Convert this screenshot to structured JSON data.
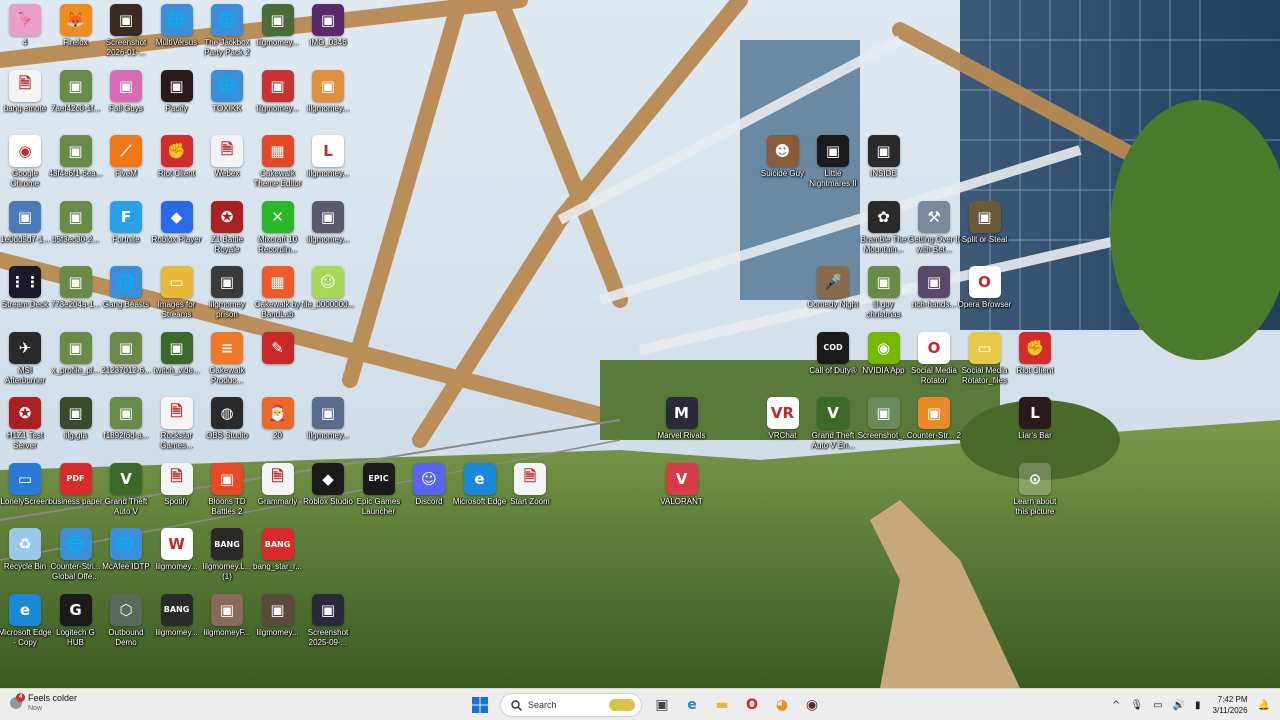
{
  "desktop": {
    "icons": [
      {
        "label": "4",
        "col": 0,
        "row": 0,
        "color": "#e8a0c8",
        "glyph": "🦩"
      },
      {
        "label": "Firefox",
        "col": 1,
        "row": 0,
        "color": "#f28b1f",
        "glyph": "🦊"
      },
      {
        "label": "Screenshot 2026-01-...",
        "col": 2,
        "row": 0,
        "color": "#3a2a22",
        "glyph": "▣"
      },
      {
        "label": "MultiVersus",
        "col": 3,
        "row": 0,
        "color": "#3b8fd8",
        "glyph": "🌐"
      },
      {
        "label": "The Jackbox Party Pack 2",
        "col": 4,
        "row": 0,
        "color": "#3b8fd8",
        "glyph": "🌐"
      },
      {
        "label": "lilgmomey...",
        "col": 5,
        "row": 0,
        "color": "#4a6b3a",
        "glyph": "▣"
      },
      {
        "label": "IMG_0346",
        "col": 6,
        "row": 0,
        "color": "#5a2a6a",
        "glyph": "▣"
      },
      {
        "label": "bang emote",
        "col": 0,
        "row": 1,
        "color": "#f4f4f4",
        "glyph": "🗎"
      },
      {
        "label": "7aef42c0-1f...",
        "col": 1,
        "row": 1,
        "color": "#6a8a4a",
        "glyph": "▣"
      },
      {
        "label": "Fall Guys",
        "col": 2,
        "row": 1,
        "color": "#d96ab4",
        "glyph": "▣"
      },
      {
        "label": "Pacify",
        "col": 3,
        "row": 1,
        "color": "#2a1a1a",
        "glyph": "▣"
      },
      {
        "label": "TOXIKK",
        "col": 4,
        "row": 1,
        "color": "#3b8fd8",
        "glyph": "🌐"
      },
      {
        "label": "lilgmomey...",
        "col": 5,
        "row": 1,
        "color": "#c83232",
        "glyph": "▣"
      },
      {
        "label": "lilgmomey...",
        "col": 6,
        "row": 1,
        "color": "#e09040",
        "glyph": "▣"
      },
      {
        "label": "Google Chrome",
        "col": 0,
        "row": 2,
        "color": "#ffffff",
        "glyph": "◉"
      },
      {
        "label": "43f4e6f1-6ea...",
        "col": 1,
        "row": 2,
        "color": "#6a8a4a",
        "glyph": "▣"
      },
      {
        "label": "FiveM",
        "col": 2,
        "row": 2,
        "color": "#f07818",
        "glyph": "⟋"
      },
      {
        "label": "Riot Client",
        "col": 3,
        "row": 2,
        "color": "#d32c2c",
        "glyph": "✊"
      },
      {
        "label": "Webex",
        "col": 4,
        "row": 2,
        "color": "#f4f4f4",
        "glyph": "🗎"
      },
      {
        "label": "Cakewalk Theme Editor",
        "col": 5,
        "row": 2,
        "color": "#e04828",
        "glyph": "▦"
      },
      {
        "label": "lilgmomey...",
        "col": 6,
        "row": 2,
        "color": "#ffffff",
        "glyph": "L"
      },
      {
        "label": "1e0dd5d7-1...",
        "col": 0,
        "row": 3,
        "color": "#4a7ab8",
        "glyph": "▣"
      },
      {
        "label": "b5f3ec30-2...",
        "col": 1,
        "row": 3,
        "color": "#6a8a4a",
        "glyph": "▣"
      },
      {
        "label": "Fortnite",
        "col": 2,
        "row": 3,
        "color": "#2aa0e8",
        "glyph": "F"
      },
      {
        "label": "Roblox Player",
        "col": 3,
        "row": 3,
        "color": "#2a6ae8",
        "glyph": "◆"
      },
      {
        "label": "Z1 Battle Royale",
        "col": 4,
        "row": 3,
        "color": "#a82020",
        "glyph": "✪"
      },
      {
        "label": "Mixcraft 10 Recordin...",
        "col": 5,
        "row": 3,
        "color": "#28b828",
        "glyph": "✕"
      },
      {
        "label": "lilgmomey...",
        "col": 6,
        "row": 3,
        "color": "#5a5a6a",
        "glyph": "▣"
      },
      {
        "label": "Stream Deck",
        "col": 0,
        "row": 4,
        "color": "#1a1a2a",
        "glyph": "⋮⋮"
      },
      {
        "label": "773e204a-1...",
        "col": 1,
        "row": 4,
        "color": "#6a8a4a",
        "glyph": "▣"
      },
      {
        "label": "Gang Beasts",
        "col": 2,
        "row": 4,
        "color": "#3b8fd8",
        "glyph": "🌐"
      },
      {
        "label": "Images for Streams",
        "col": 3,
        "row": 4,
        "color": "#e8b838",
        "glyph": "▭"
      },
      {
        "label": "lilgmomey prison",
        "col": 4,
        "row": 4,
        "color": "#3a3a3a",
        "glyph": "▣"
      },
      {
        "label": "Cakewalk by BandLab",
        "col": 5,
        "row": 4,
        "color": "#f05a28",
        "glyph": "▦"
      },
      {
        "label": "file_0000000...",
        "col": 6,
        "row": 4,
        "color": "#a8d858",
        "glyph": "☺"
      },
      {
        "label": "MSI Afterburner",
        "col": 0,
        "row": 5,
        "color": "#2a2a2a",
        "glyph": "✈"
      },
      {
        "label": "x_profile_pl...",
        "col": 1,
        "row": 5,
        "color": "#6a8a4a",
        "glyph": "▣"
      },
      {
        "label": "21237012-6...",
        "col": 2,
        "row": 5,
        "color": "#6a8a4a",
        "glyph": "▣"
      },
      {
        "label": "twitch_vide...",
        "col": 3,
        "row": 5,
        "color": "#3a6a2a",
        "glyph": "▣"
      },
      {
        "label": "Cakewalk Produc...",
        "col": 4,
        "row": 5,
        "color": "#f07828",
        "glyph": "≡"
      },
      {
        "label": "",
        "col": 5,
        "row": 5,
        "color": "#c82828",
        "glyph": "✎"
      },
      {
        "label": "H1Z1 Test Server",
        "col": 0,
        "row": 6,
        "color": "#a82020",
        "glyph": "✪"
      },
      {
        "label": "lilg.gta",
        "col": 1,
        "row": 6,
        "color": "#3a4a2a",
        "glyph": "▣"
      },
      {
        "label": "f1892f6d-a...",
        "col": 2,
        "row": 6,
        "color": "#6a8a4a",
        "glyph": "▣"
      },
      {
        "label": "Rockstar Games...",
        "col": 3,
        "row": 6,
        "color": "#f4f4f4",
        "glyph": "🗎"
      },
      {
        "label": "OBS Studio",
        "col": 4,
        "row": 6,
        "color": "#2a2a2a",
        "glyph": "◍"
      },
      {
        "label": "20",
        "col": 5,
        "row": 6,
        "color": "#e86828",
        "glyph": "🎅"
      },
      {
        "label": "lilgmomey...",
        "col": 6,
        "row": 6,
        "color": "#5a6a8a",
        "glyph": "▣"
      },
      {
        "label": "LonelyScreen",
        "col": 0,
        "row": 7,
        "color": "#2a78d8",
        "glyph": "▭"
      },
      {
        "label": "business paper",
        "col": 1,
        "row": 7,
        "color": "#d82a2a",
        "glyph": "PDF"
      },
      {
        "label": "Grand Theft Auto V",
        "col": 2,
        "row": 7,
        "color": "#3a6a2a",
        "glyph": "V"
      },
      {
        "label": "Spotify",
        "col": 3,
        "row": 7,
        "color": "#f4f4f4",
        "glyph": "🗎"
      },
      {
        "label": "Bloons TD Battles 2",
        "col": 4,
        "row": 7,
        "color": "#e84828",
        "glyph": "▣"
      },
      {
        "label": "Grammarly",
        "col": 5,
        "row": 7,
        "color": "#f4f4f4",
        "glyph": "🗎"
      },
      {
        "label": "Roblox Studio",
        "col": 6,
        "row": 7,
        "color": "#1a1a1a",
        "glyph": "◆"
      },
      {
        "label": "Epic Games Launcher",
        "col": 7,
        "row": 7,
        "color": "#1a1a1a",
        "glyph": "EPIC"
      },
      {
        "label": "Discord",
        "col": 8,
        "row": 7,
        "color": "#5865f2",
        "glyph": "☺"
      },
      {
        "label": "Microsoft Edge",
        "col": 9,
        "row": 7,
        "color": "#1a8ad8",
        "glyph": "e"
      },
      {
        "label": "Start Zoom",
        "col": 10,
        "row": 7,
        "color": "#f4f4f4",
        "glyph": "🗎"
      },
      {
        "label": "Recycle Bin",
        "col": 0,
        "row": 8,
        "color": "#9ac8e8",
        "glyph": "♻"
      },
      {
        "label": "Counter-Stri... Global Offe...",
        "col": 1,
        "row": 8,
        "color": "#3b8fd8",
        "glyph": "🌐"
      },
      {
        "label": "McAfee IDTP",
        "col": 2,
        "row": 8,
        "color": "#3b8fd8",
        "glyph": "🌐"
      },
      {
        "label": "lilgmomey...",
        "col": 3,
        "row": 8,
        "color": "#ffffff",
        "glyph": "W"
      },
      {
        "label": "lilgmomey.L... (1)",
        "col": 4,
        "row": 8,
        "color": "#2a2a2a",
        "glyph": "BANG"
      },
      {
        "label": "bang_star_r...",
        "col": 5,
        "row": 8,
        "color": "#d82a2a",
        "glyph": "BANG"
      },
      {
        "label": "Microsoft Edge - Copy",
        "col": 0,
        "row": 9,
        "color": "#1a8ad8",
        "glyph": "e"
      },
      {
        "label": "Logitech G HUB",
        "col": 1,
        "row": 9,
        "color": "#1a1a1a",
        "glyph": "G"
      },
      {
        "label": "Outbound Demo",
        "col": 2,
        "row": 9,
        "color": "#5a6a5a",
        "glyph": "⬡"
      },
      {
        "label": "lilgmomey...",
        "col": 3,
        "row": 9,
        "color": "#2a2a2a",
        "glyph": "BANG"
      },
      {
        "label": "lilgmomeyF...",
        "col": 4,
        "row": 9,
        "color": "#8a6a5a",
        "glyph": "▣"
      },
      {
        "label": "lilgmomey...",
        "col": 5,
        "row": 9,
        "color": "#5a4a3a",
        "glyph": "▣"
      },
      {
        "label": "Screenshot 2025-09-...",
        "col": 6,
        "row": 9,
        "color": "#2a2a3a",
        "glyph": "▣"
      },
      {
        "label": "Suicide Guy",
        "col": 15,
        "row": 2,
        "color": "#8a5a3a",
        "glyph": "☻"
      },
      {
        "label": "Little Nightmares II",
        "col": 16,
        "row": 2,
        "color": "#1a1a1a",
        "glyph": "▣"
      },
      {
        "label": "INSIDE",
        "col": 17,
        "row": 2,
        "color": "#2a2a2a",
        "glyph": "▣"
      },
      {
        "label": "Bramble The Mountain...",
        "col": 17,
        "row": 3,
        "color": "#2a2a2a",
        "glyph": "✿"
      },
      {
        "label": "Getting Over It with Bet...",
        "col": 18,
        "row": 3,
        "color": "#7a8a9a",
        "glyph": "⚒"
      },
      {
        "label": "Split or Steal",
        "col": 19,
        "row": 3,
        "color": "#6a5a3a",
        "glyph": "▣"
      },
      {
        "label": "Comedy Night",
        "col": 16,
        "row": 4,
        "color": "#8a6a4a",
        "glyph": "🎤"
      },
      {
        "label": "lil guy christmas",
        "col": 17,
        "row": 4,
        "color": "#6a8a4a",
        "glyph": "▣"
      },
      {
        "label": "rich-hands...",
        "col": 18,
        "row": 4,
        "color": "#5a4a6a",
        "glyph": "▣"
      },
      {
        "label": "Opera Browser",
        "col": 19,
        "row": 4,
        "color": "#ffffff",
        "glyph": "O"
      },
      {
        "label": "Call of Duty®",
        "col": 16,
        "row": 5,
        "color": "#1a1a1a",
        "glyph": "COD"
      },
      {
        "label": "NVIDIA App",
        "col": 17,
        "row": 5,
        "color": "#76b900",
        "glyph": "◉"
      },
      {
        "label": "Social Media Rotator",
        "col": 18,
        "row": 5,
        "color": "#ffffff",
        "glyph": "O"
      },
      {
        "label": "Social Media Rotator_files",
        "col": 19,
        "row": 5,
        "color": "#e8c848",
        "glyph": "▭"
      },
      {
        "label": "Riot Client",
        "col": 20,
        "row": 5,
        "color": "#d32c2c",
        "glyph": "✊"
      },
      {
        "label": "Marvel Rivals",
        "col": 13,
        "row": 6,
        "color": "#2a2a3a",
        "glyph": "M"
      },
      {
        "label": "VRChat",
        "col": 15,
        "row": 6,
        "color": "#ffffff",
        "glyph": "VR"
      },
      {
        "label": "Grand Theft Auto V En...",
        "col": 16,
        "row": 6,
        "color": "#3a6a2a",
        "glyph": "V"
      },
      {
        "label": "Screenshot_...",
        "col": 17,
        "row": 6,
        "color": "#6a8a5a",
        "glyph": "▣"
      },
      {
        "label": "Counter-Str... 2",
        "col": 18,
        "row": 6,
        "color": "#e88a28",
        "glyph": "▣"
      },
      {
        "label": "Liar's Bar",
        "col": 20,
        "row": 6,
        "color": "#2a1a1a",
        "glyph": "L"
      },
      {
        "label": "VALORANT",
        "col": 13,
        "row": 7,
        "color": "#d83a48",
        "glyph": "V"
      },
      {
        "label": "Learn about this picture",
        "col": 20,
        "row": 7,
        "color": "rgba(255,255,255,0.2)",
        "glyph": "⊙"
      }
    ]
  },
  "taskbar": {
    "weather": {
      "badge": "4",
      "title": "Feels colder",
      "subtitle": "Now"
    },
    "search_placeholder": "Search",
    "pinned": [
      {
        "name": "start-button",
        "glyph": "⊞",
        "color": "#1a73d8"
      },
      {
        "name": "task-view-button",
        "glyph": "▣",
        "color": "#444"
      },
      {
        "name": "edge-taskbar-button",
        "glyph": "e",
        "color": "#1a8ad8"
      },
      {
        "name": "file-explorer-button",
        "glyph": "▬",
        "color": "#e8b838"
      },
      {
        "name": "opera-taskbar-button",
        "glyph": "O",
        "color": "#e0201a"
      },
      {
        "name": "firefox-taskbar-button",
        "glyph": "◕",
        "color": "#f28b1f"
      },
      {
        "name": "app-taskbar-button",
        "glyph": "◉",
        "color": "#5a2a2a"
      }
    ],
    "tray": {
      "chevron": "^",
      "mic": "🎙",
      "network": "▭",
      "volume": "🔊",
      "battery": "▮"
    },
    "clock": {
      "time": "7:42 PM",
      "date": "3/11/2026"
    },
    "bell": "🔔"
  }
}
